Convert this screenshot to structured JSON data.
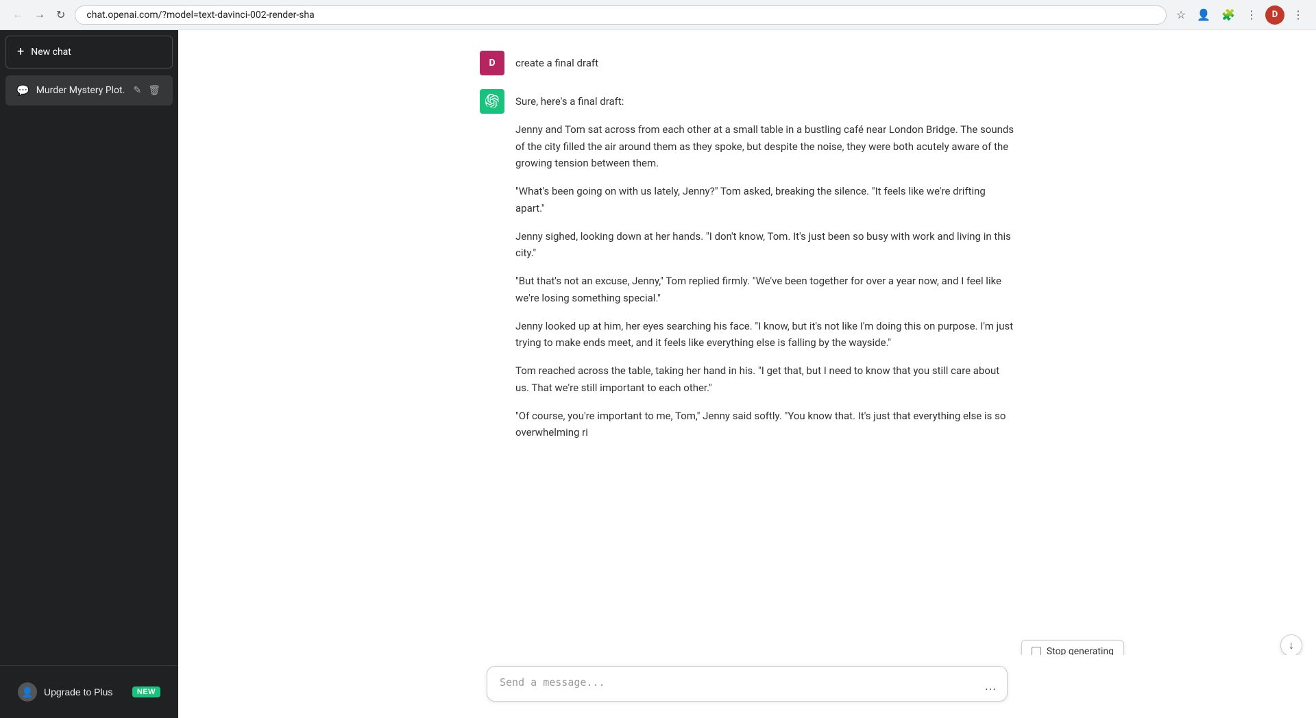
{
  "browser": {
    "url": "chat.openai.com/?model=text-davinci-002-render-sha",
    "avatar_initial": "D"
  },
  "sidebar": {
    "new_chat_label": "New chat",
    "chat_items": [
      {
        "label": "Murder Mystery Plot."
      }
    ],
    "upgrade_label": "Upgrade to Plus",
    "upgrade_badge": "NEW"
  },
  "chat": {
    "user_message": "create a final draft",
    "assistant_intro": "Sure, here's a final draft:",
    "paragraphs": [
      "Jenny and Tom sat across from each other at a small table in a bustling café near London Bridge. The sounds of the city filled the air around them as they spoke, but despite the noise, they were both acutely aware of the growing tension between them.",
      "\"What's been going on with us lately, Jenny?\" Tom asked, breaking the silence. \"It feels like we're drifting apart.\"",
      "Jenny sighed, looking down at her hands. \"I don't know, Tom. It's just been so busy with work and living in this city.\"",
      "\"But that's not an excuse, Jenny,\" Tom replied firmly. \"We've been together for over a year now, and I feel like we're losing something special.\"",
      "Jenny looked up at him, her eyes searching his face. \"I know, but it's not like I'm doing this on purpose. I'm just trying to make ends meet, and it feels like everything else is falling by the wayside.\"",
      "Tom reached across the table, taking her hand in his. \"I get that, but I need to know that you still care about us. That we're still important to each other.\"",
      "\"Of course, you're important to me, Tom,\" Jenny said softly. \"You know that. It's just that everything else is so overwhelming ri"
    ]
  },
  "input": {
    "placeholder": "Send a message..."
  },
  "stop_generating": {
    "label": "Stop generating"
  },
  "icons": {
    "back": "←",
    "forward": "→",
    "reload": "↻",
    "more_browser": "⋮",
    "more_input": "…",
    "scroll_down": "↓",
    "plus": "+",
    "chat": "💬",
    "edit": "✎",
    "trash": "🗑",
    "user": "👤",
    "openai_logo": "✦"
  }
}
